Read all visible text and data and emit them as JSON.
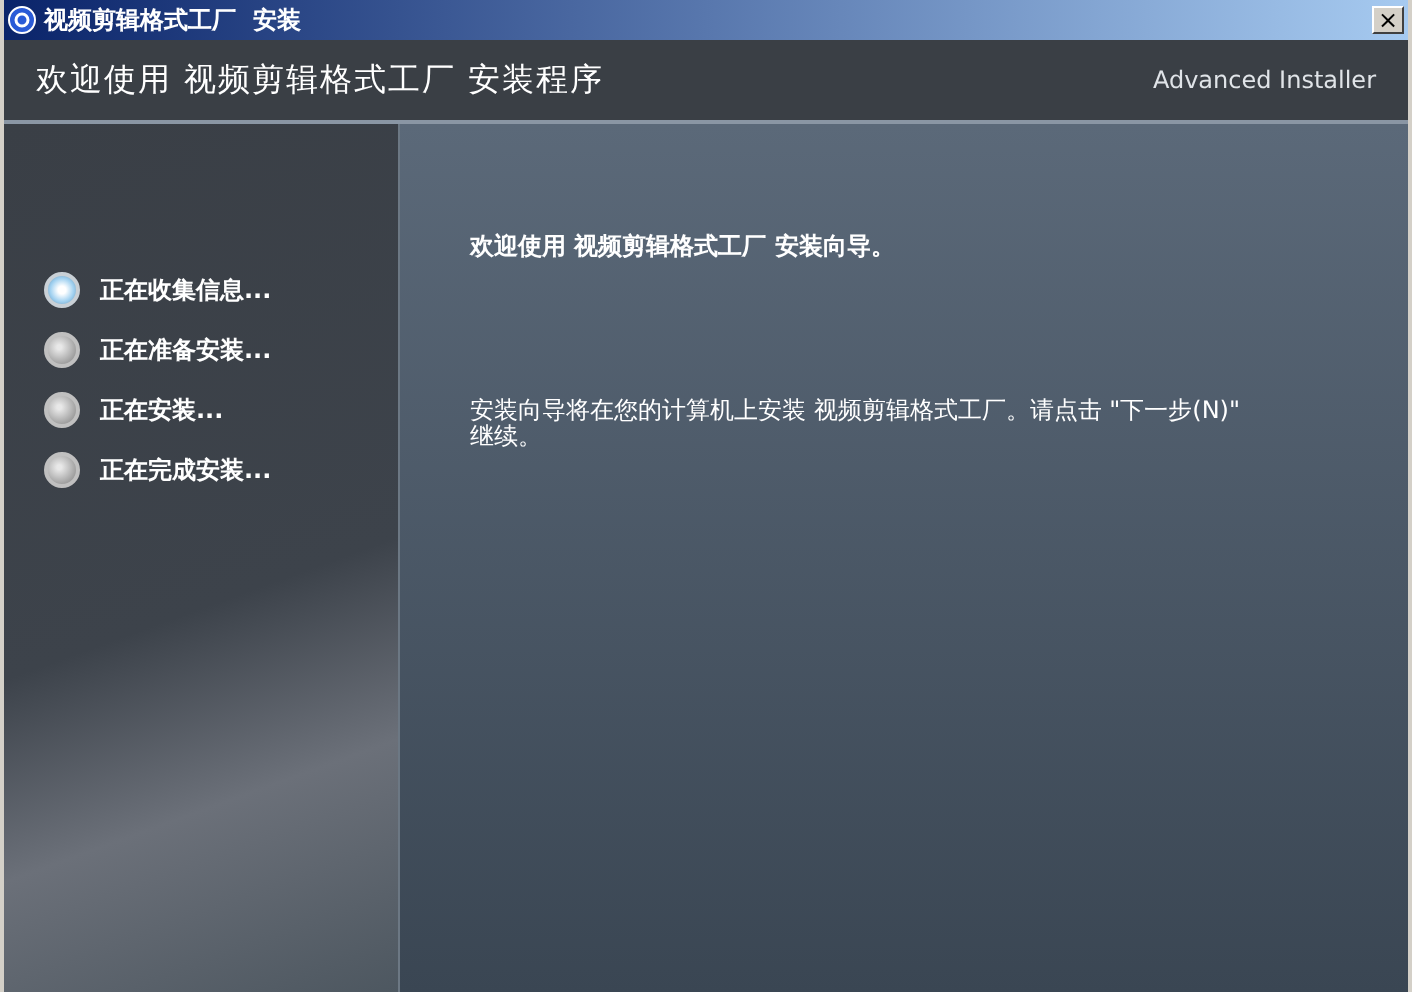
{
  "window": {
    "title": "视频剪辑格式工厂  安装",
    "close": "×"
  },
  "header": {
    "title": "欢迎使用 视频剪辑格式工厂 安装程序",
    "brand": "Advanced Installer"
  },
  "steps": [
    {
      "label": "正在收集信息...",
      "selected": true
    },
    {
      "label": "正在准备安装...",
      "selected": false
    },
    {
      "label": "正在安装...",
      "selected": false
    },
    {
      "label": "正在完成安装...",
      "selected": false
    }
  ],
  "content": {
    "heading": "欢迎使用 视频剪辑格式工厂 安装向导。",
    "body": "安装向导将在您的计算机上安装 视频剪辑格式工厂。请点击 \"下一步(N)\" 继续。"
  }
}
